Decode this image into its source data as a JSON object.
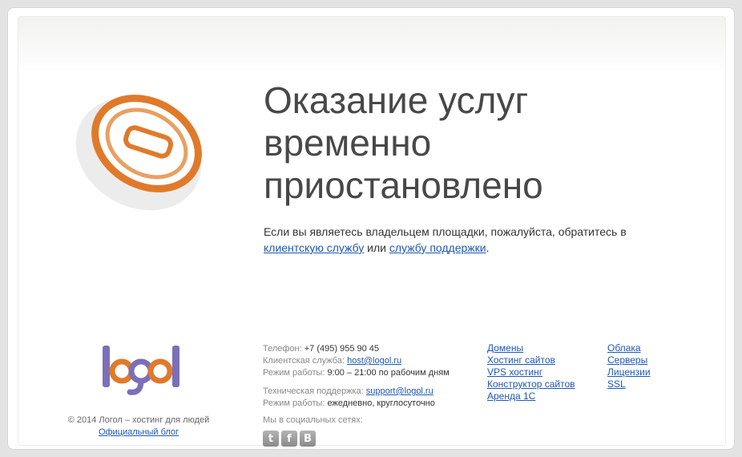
{
  "heading": "Оказание услуг временно приостановлено",
  "notice": {
    "text_before": "Если вы являетесь владельцем площадки, пожалуйста, обратитесь в ",
    "link_client": "клиентскую службу",
    "text_mid": " или ",
    "link_support": "службу поддержки",
    "text_after": "."
  },
  "footer": {
    "copyright": "© 2014 Логол – хостинг для людей",
    "blog_link": "Официальный блог",
    "phone_label": "Телефон: ",
    "phone": "+7 (495) 955 90 45",
    "client_label": "Клиентская служба: ",
    "client_email": "host@logol.ru",
    "hours_label": "Режим работы: ",
    "client_hours": "9:00 – 21:00 по рабочим дням",
    "support_label": "Техническая поддержка: ",
    "support_email": "support@logol.ru",
    "support_hours_label": "Режим работы: ",
    "support_hours": "ежедневно, круглосуточно",
    "social_title": "Мы в социальных сетях:",
    "social": [
      {
        "icon": "twitter-icon",
        "glyph": "t"
      },
      {
        "icon": "facebook-icon",
        "glyph": "f"
      },
      {
        "icon": "vkontakte-icon",
        "glyph": "В"
      }
    ],
    "links_col1": [
      "Домены",
      "Хостинг сайтов",
      "VPS хостинг",
      "Конструктор сайтов",
      "Аренда 1С"
    ],
    "links_col2": [
      "Облака",
      "Серверы",
      "Лицензии",
      "SSL"
    ]
  },
  "colors": {
    "accent_orange": "#e07a2a",
    "link": "#1f58b4",
    "brand_purple": "#7b6fb8"
  }
}
